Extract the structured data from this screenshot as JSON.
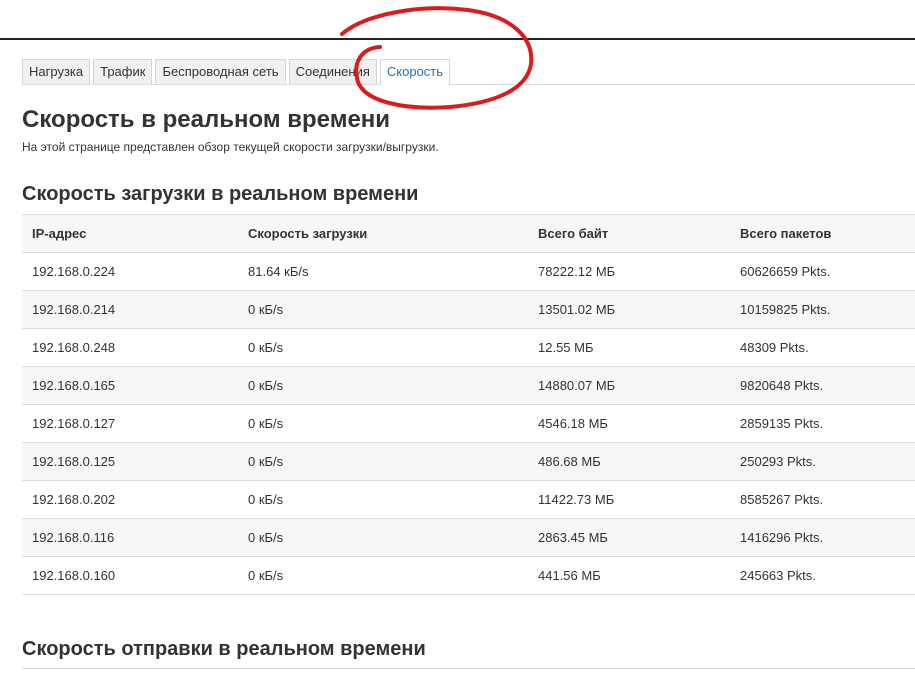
{
  "tabs": [
    {
      "label": "Нагрузка",
      "active": false
    },
    {
      "label": "Трафик",
      "active": false
    },
    {
      "label": "Беспроводная сеть",
      "active": false
    },
    {
      "label": "Соединения",
      "active": false
    },
    {
      "label": "Скорость",
      "active": true
    }
  ],
  "page": {
    "title": "Скорость в реальном времени",
    "description": "На этой странице представлен обзор текущей скорости загрузки/выгрузки."
  },
  "download": {
    "title": "Скорость загрузки в реальном времени",
    "headers": [
      "IP-адрес",
      "Скорость загрузки",
      "Всего байт",
      "Всего пакетов"
    ],
    "rows": [
      [
        "192.168.0.224",
        "81.64 кБ/s",
        "78222.12 МБ",
        "60626659 Pkts."
      ],
      [
        "192.168.0.214",
        "0 кБ/s",
        "13501.02 МБ",
        "10159825 Pkts."
      ],
      [
        "192.168.0.248",
        "0 кБ/s",
        "12.55 МБ",
        "48309 Pkts."
      ],
      [
        "192.168.0.165",
        "0 кБ/s",
        "14880.07 МБ",
        "9820648 Pkts."
      ],
      [
        "192.168.0.127",
        "0 кБ/s",
        "4546.18 МБ",
        "2859135 Pkts."
      ],
      [
        "192.168.0.125",
        "0 кБ/s",
        "486.68 МБ",
        "250293 Pkts."
      ],
      [
        "192.168.0.202",
        "0 кБ/s",
        "11422.73 МБ",
        "8585267 Pkts."
      ],
      [
        "192.168.0.116",
        "0 кБ/s",
        "2863.45 МБ",
        "1416296 Pkts."
      ],
      [
        "192.168.0.160",
        "0 кБ/s",
        "441.56 МБ",
        "245663 Pkts."
      ]
    ]
  },
  "upload": {
    "title": "Скорость отправки в реальном времени"
  },
  "colors": {
    "active_tab": "#2a6fb5",
    "annotation": "#d91c1c"
  }
}
